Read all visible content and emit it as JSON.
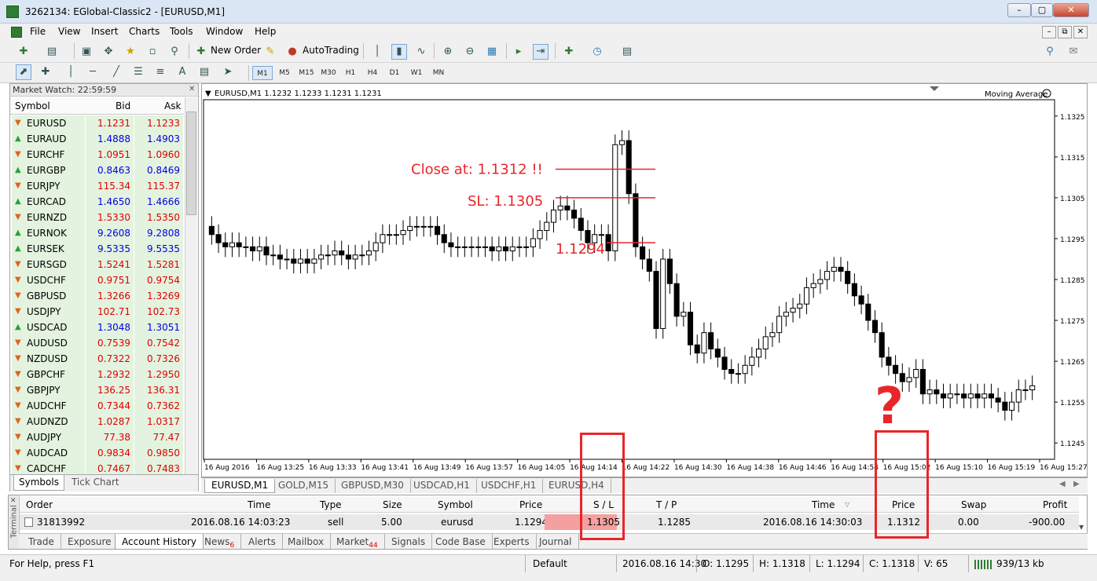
{
  "window": {
    "title": "3262134: EGlobal-Classic2 - [EURUSD,M1]"
  },
  "menu": [
    "File",
    "View",
    "Insert",
    "Charts",
    "Tools",
    "Window",
    "Help"
  ],
  "toolbar": {
    "new_order": "New Order",
    "autotrading": "AutoTrading"
  },
  "timeframes": [
    "M1",
    "M5",
    "M15",
    "M30",
    "H1",
    "H4",
    "D1",
    "W1",
    "MN"
  ],
  "market_watch": {
    "header": "Market Watch: 22:59:59",
    "columns": {
      "symbol": "Symbol",
      "bid": "Bid",
      "ask": "Ask"
    },
    "rows": [
      {
        "symbol": "EURUSD",
        "bid": "1.1231",
        "ask": "1.1233",
        "dir": "down"
      },
      {
        "symbol": "EURAUD",
        "bid": "1.4888",
        "ask": "1.4903",
        "dir": "up"
      },
      {
        "symbol": "EURCHF",
        "bid": "1.0951",
        "ask": "1.0960",
        "dir": "down"
      },
      {
        "symbol": "EURGBP",
        "bid": "0.8463",
        "ask": "0.8469",
        "dir": "up"
      },
      {
        "symbol": "EURJPY",
        "bid": "115.34",
        "ask": "115.37",
        "dir": "down"
      },
      {
        "symbol": "EURCAD",
        "bid": "1.4650",
        "ask": "1.4666",
        "dir": "up"
      },
      {
        "symbol": "EURNZD",
        "bid": "1.5330",
        "ask": "1.5350",
        "dir": "down"
      },
      {
        "symbol": "EURNOK",
        "bid": "9.2608",
        "ask": "9.2808",
        "dir": "up"
      },
      {
        "symbol": "EURSEK",
        "bid": "9.5335",
        "ask": "9.5535",
        "dir": "up"
      },
      {
        "symbol": "EURSGD",
        "bid": "1.5241",
        "ask": "1.5281",
        "dir": "down"
      },
      {
        "symbol": "USDCHF",
        "bid": "0.9751",
        "ask": "0.9754",
        "dir": "down"
      },
      {
        "symbol": "GBPUSD",
        "bid": "1.3266",
        "ask": "1.3269",
        "dir": "down"
      },
      {
        "symbol": "USDJPY",
        "bid": "102.71",
        "ask": "102.73",
        "dir": "down"
      },
      {
        "symbol": "USDCAD",
        "bid": "1.3048",
        "ask": "1.3051",
        "dir": "up"
      },
      {
        "symbol": "AUDUSD",
        "bid": "0.7539",
        "ask": "0.7542",
        "dir": "down"
      },
      {
        "symbol": "NZDUSD",
        "bid": "0.7322",
        "ask": "0.7326",
        "dir": "down"
      },
      {
        "symbol": "GBPCHF",
        "bid": "1.2932",
        "ask": "1.2950",
        "dir": "down"
      },
      {
        "symbol": "GBPJPY",
        "bid": "136.25",
        "ask": "136.31",
        "dir": "down"
      },
      {
        "symbol": "AUDCHF",
        "bid": "0.7344",
        "ask": "0.7362",
        "dir": "down"
      },
      {
        "symbol": "AUDNZD",
        "bid": "1.0287",
        "ask": "1.0317",
        "dir": "down"
      },
      {
        "symbol": "AUDJPY",
        "bid": "77.38",
        "ask": "77.47",
        "dir": "down"
      },
      {
        "symbol": "AUDCAD",
        "bid": "0.9834",
        "ask": "0.9850",
        "dir": "down"
      },
      {
        "symbol": "CADCHF",
        "bid": "0.7467",
        "ask": "0.7483",
        "dir": "down"
      }
    ],
    "tabs": [
      "Symbols",
      "Tick Chart"
    ]
  },
  "chart": {
    "header": "EURUSD,M1  1.1232 1.1233 1.1231 1.1231",
    "indicator": "Moving Average",
    "annotations": {
      "close": "Close at: 1.1312 !!",
      "sl": "SL:  1.1305",
      "entry": "1.1294",
      "question": "?"
    },
    "price_axis": [
      "1.1325",
      "1.1315",
      "1.1305",
      "1.1295",
      "1.1285",
      "1.1275",
      "1.1265",
      "1.1255",
      "1.1245"
    ],
    "time_axis": [
      "16 Aug 2016",
      "16 Aug 13:25",
      "16 Aug 13:33",
      "16 Aug 13:41",
      "16 Aug 13:49",
      "16 Aug 13:57",
      "16 Aug 14:05",
      "16 Aug 14:14",
      "16 Aug 14:22",
      "16 Aug 14:30",
      "16 Aug 14:38",
      "16 Aug 14:46",
      "16 Aug 14:54",
      "16 Aug 15:02",
      "16 Aug 15:10",
      "16 Aug 15:19",
      "16 Aug 15:27"
    ],
    "colors": {
      "annotation": "#e8262a",
      "bear": "#000000",
      "bull": "#ffffff"
    }
  },
  "chart_data": {
    "type": "candlestick",
    "symbol": "EURUSD",
    "timeframe": "M1",
    "ylim": [
      1.1241,
      1.1329
    ],
    "levels": {
      "close": 1.1312,
      "sl": 1.1305,
      "entry": 1.1294
    },
    "closes": [
      1.1296,
      1.1294,
      1.1293,
      1.1294,
      1.1293,
      1.1293,
      1.1292,
      1.1293,
      1.1291,
      1.1291,
      1.129,
      1.129,
      1.1289,
      1.129,
      1.1289,
      1.129,
      1.1291,
      1.1291,
      1.1292,
      1.1291,
      1.129,
      1.1291,
      1.1291,
      1.1292,
      1.1294,
      1.1296,
      1.1296,
      1.1296,
      1.1297,
      1.1298,
      1.1298,
      1.1298,
      1.1298,
      1.1296,
      1.1294,
      1.1293,
      1.1293,
      1.1293,
      1.1293,
      1.1293,
      1.1293,
      1.1292,
      1.1293,
      1.1292,
      1.1293,
      1.1293,
      1.1293,
      1.1295,
      1.1297,
      1.1299,
      1.1302,
      1.1303,
      1.1302,
      1.13,
      1.1297,
      1.1294,
      1.1296,
      1.1296,
      1.1292,
      1.1318,
      1.1319,
      1.1306,
      1.1293,
      1.129,
      1.1287,
      1.1273,
      1.129,
      1.1284,
      1.1276,
      1.1277,
      1.1269,
      1.1267,
      1.1272,
      1.1268,
      1.1266,
      1.1263,
      1.1262,
      1.1262,
      1.1264,
      1.1266,
      1.1268,
      1.1271,
      1.1272,
      1.1276,
      1.1277,
      1.1278,
      1.1279,
      1.1283,
      1.1284,
      1.1285,
      1.1287,
      1.1288,
      1.1287,
      1.1284,
      1.1281,
      1.1279,
      1.1275,
      1.1272,
      1.1266,
      1.1264,
      1.1262,
      1.126,
      1.1261,
      1.1263,
      1.1257,
      1.1258,
      1.1257,
      1.1256,
      1.1257,
      1.1257,
      1.1256,
      1.1257,
      1.1256,
      1.1257,
      1.1256,
      1.1255,
      1.1253,
      1.1255,
      1.1258,
      1.1258,
      1.1259
    ]
  },
  "chart_tabs": [
    "EURUSD,M1",
    "GOLD,M15",
    "GBPUSD,M30",
    "USDCAD,H1",
    "USDCHF,H1",
    "EURUSD,H4"
  ],
  "terminal": {
    "side_label": "Terminal",
    "columns": [
      "Order",
      "Time",
      "Type",
      "Size",
      "Symbol",
      "Price",
      "S / L",
      "T / P",
      "Time",
      "Price",
      "Swap",
      "Profit"
    ],
    "row": {
      "order": "31813992",
      "open_time": "2016.08.16 14:03:23",
      "type": "sell",
      "size": "5.00",
      "symbol": "eurusd",
      "price": "1.1294",
      "sl": "1.1305",
      "tp": "1.1285",
      "close_time": "2016.08.16 14:30:03",
      "close_price": "1.1312",
      "swap": "0.00",
      "profit": "-900.00"
    },
    "tabs": [
      "Trade",
      "Exposure",
      "Account History",
      "News",
      "Alerts",
      "Mailbox",
      "Market",
      "Signals",
      "Code Base",
      "Experts",
      "Journal"
    ],
    "news_count": "6",
    "market_count": "44"
  },
  "status": {
    "help": "For Help, press F1",
    "profile": "Default",
    "datetime": "2016.08.16 14:30",
    "open": "O: 1.1295",
    "high": "H: 1.1318",
    "low": "L: 1.1294",
    "close": "C: 1.1318",
    "volume": "V: 65",
    "traffic": "939/13 kb"
  }
}
